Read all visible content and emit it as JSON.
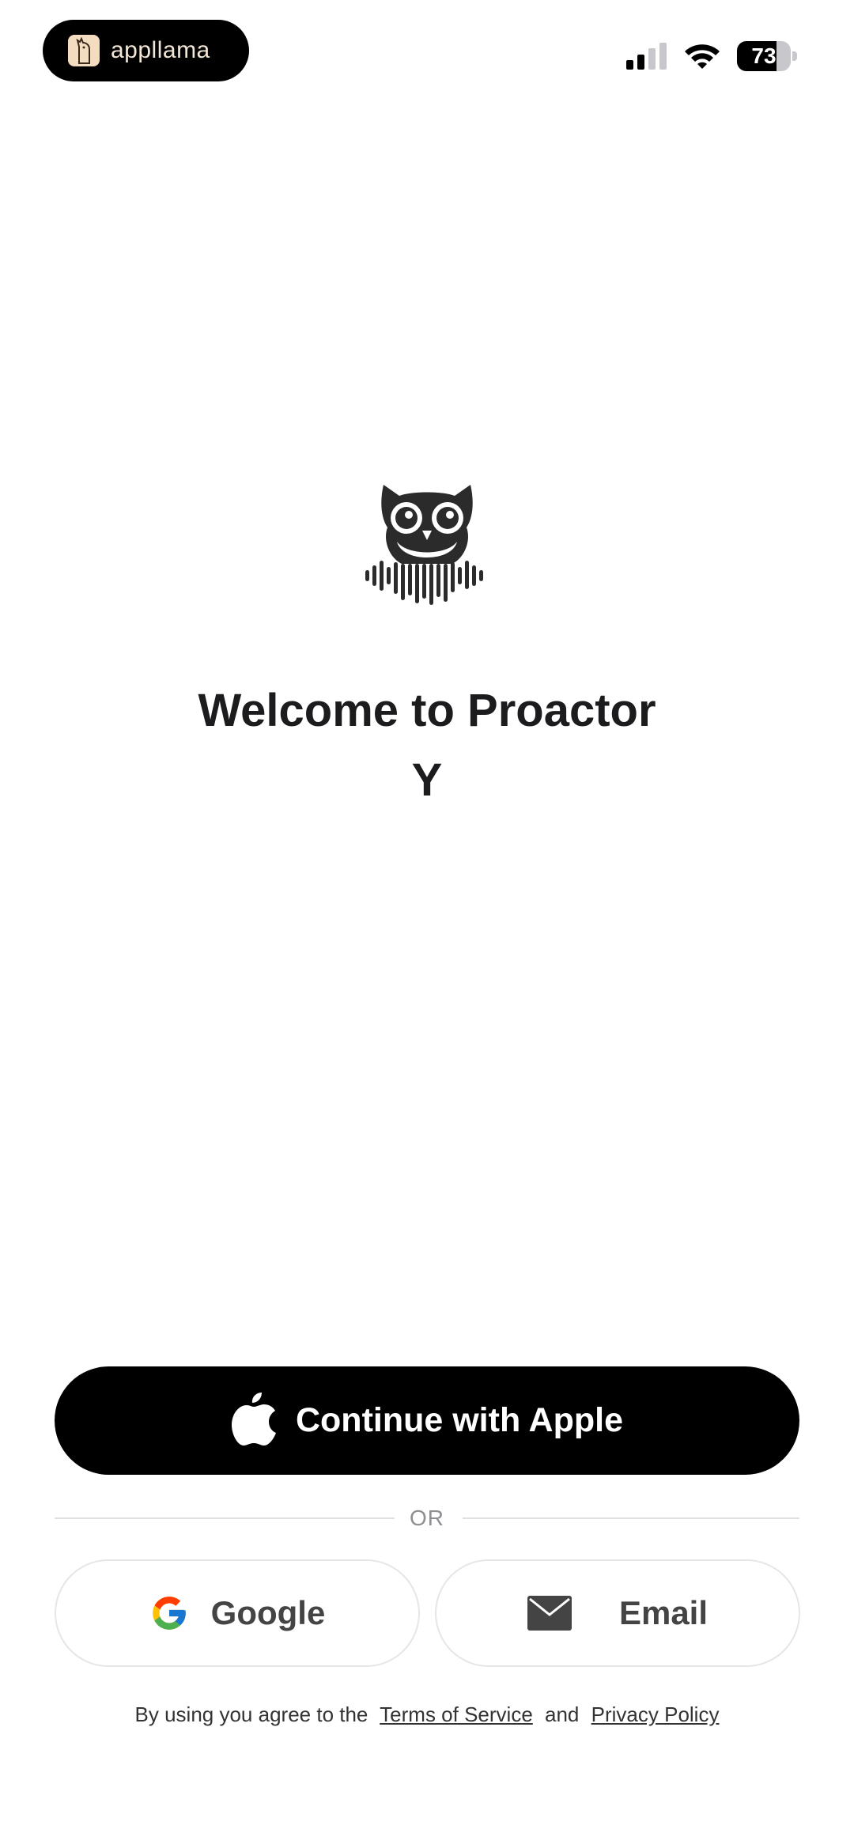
{
  "status_bar": {
    "app_badge": "appllama",
    "battery_percent": "73",
    "battery_level": 0.73
  },
  "welcome": {
    "title_line1": "Welcome to Proactor",
    "title_line2": "Y"
  },
  "buttons": {
    "apple": "Continue with Apple",
    "divider": "OR",
    "google": "Google",
    "email": "Email"
  },
  "legal": {
    "prefix": "By using you agree  to the",
    "terms": "Terms of Service",
    "and": "and",
    "privacy": "Privacy Policy"
  },
  "icons": {
    "logo": "owl-soundwave-logo-icon",
    "apple": "apple-icon",
    "google": "google-icon",
    "email": "envelope-icon"
  },
  "colors": {
    "primary_button": "#000000",
    "text": "#1c1c1e",
    "secondary_text": "#8e8e93",
    "border": "#e6e6e6"
  }
}
